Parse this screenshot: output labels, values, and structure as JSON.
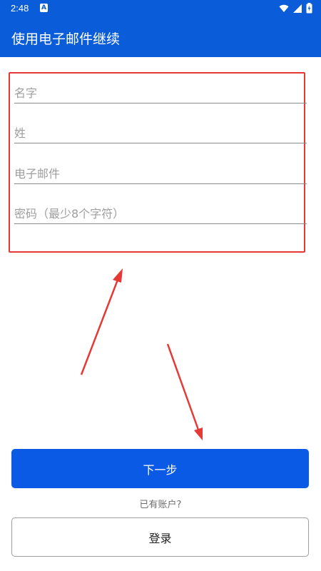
{
  "status_bar": {
    "time": "2:48",
    "notification_icon": "A",
    "icons": [
      "wifi-icon",
      "signal-icon",
      "battery-charging-icon"
    ]
  },
  "app_bar": {
    "title": "使用电子邮件继续"
  },
  "form": {
    "first_name_placeholder": "名字",
    "last_name_placeholder": "姓",
    "email_placeholder": "电子邮件",
    "password_placeholder": "密码（最少8个字符）"
  },
  "actions": {
    "next_label": "下一步",
    "have_account_text": "已有账户?",
    "login_label": "登录"
  },
  "colors": {
    "primary": "#0a5cd8",
    "button": "#0a5ae6",
    "highlight": "#e53935"
  }
}
